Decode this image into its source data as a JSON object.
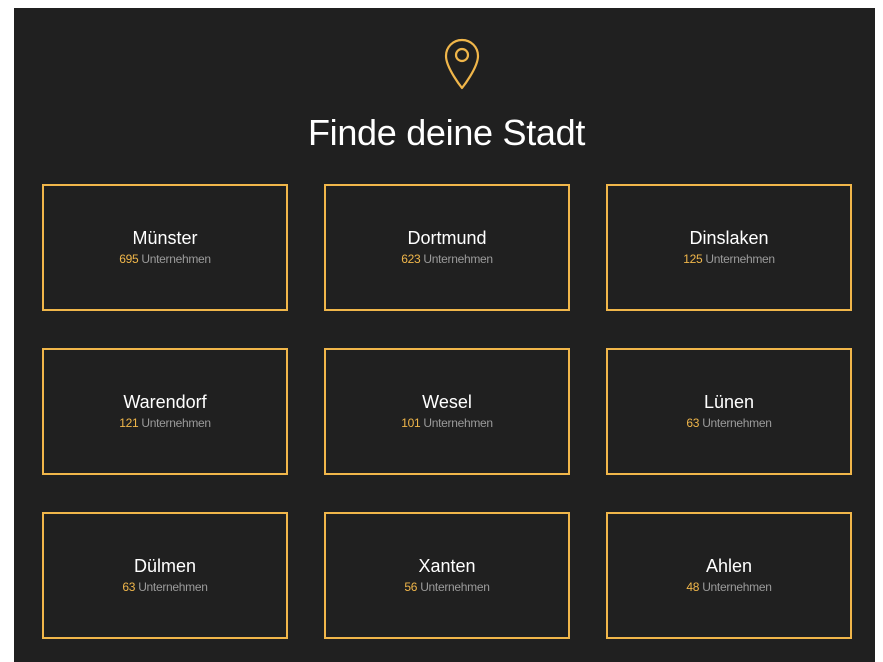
{
  "header": {
    "icon": "map-pin-icon",
    "title": "Finde deine Stadt"
  },
  "colors": {
    "background": "#202020",
    "accent": "#f0b64a",
    "text": "#ffffff",
    "muted": "#9b9b9b"
  },
  "cities": [
    {
      "name": "Münster",
      "count": "695",
      "label": "Unternehmen"
    },
    {
      "name": "Dortmund",
      "count": "623",
      "label": "Unternehmen"
    },
    {
      "name": "Dinslaken",
      "count": "125",
      "label": "Unternehmen"
    },
    {
      "name": "Warendorf",
      "count": "121",
      "label": "Unternehmen"
    },
    {
      "name": "Wesel",
      "count": "101",
      "label": "Unternehmen"
    },
    {
      "name": "Lünen",
      "count": "63",
      "label": "Unternehmen"
    },
    {
      "name": "Dülmen",
      "count": "63",
      "label": "Unternehmen"
    },
    {
      "name": "Xanten",
      "count": "56",
      "label": "Unternehmen"
    },
    {
      "name": "Ahlen",
      "count": "48",
      "label": "Unternehmen"
    }
  ]
}
